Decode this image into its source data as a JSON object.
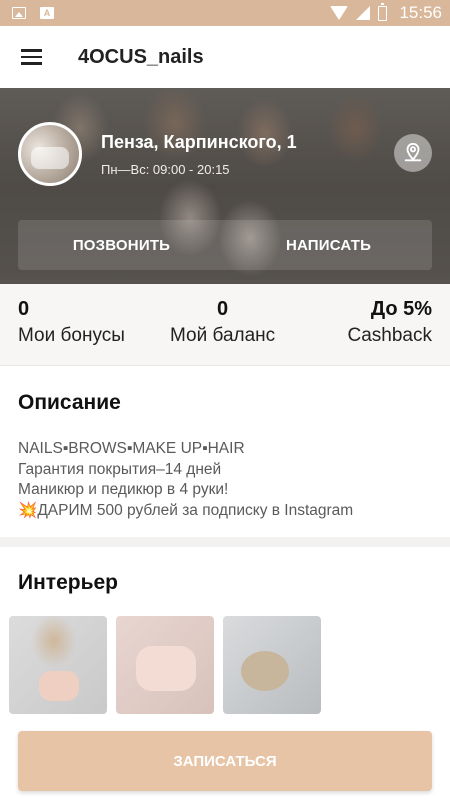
{
  "status_bar": {
    "time": "15:56"
  },
  "app_bar": {
    "title": "4OCUS_nails"
  },
  "salon": {
    "address": "Пенза, Карпинского, 1",
    "hours": "Пн—Вс: 09:00 - 20:15",
    "call_label": "ПОЗВОНИТЬ",
    "message_label": "НАПИСАТЬ"
  },
  "stats": {
    "bonuses": {
      "value": "0",
      "label": "Мои бонусы"
    },
    "balance": {
      "value": "0",
      "label": "Мой баланс"
    },
    "cashback": {
      "value": "До 5%",
      "label": "Cashback"
    }
  },
  "description": {
    "title": "Описание",
    "lines": [
      "NAILS▪BROWS▪MAKE UP▪HAIR",
      "Гарантия покрытия–14 дней",
      "Маникюр и педикюр в 4 руки!",
      "ДАРИМ 500 рублей за подписку в Instagram"
    ],
    "burst_icon": "💥"
  },
  "interior": {
    "title": "Интерьер"
  },
  "cta": {
    "label": "ЗАПИСАТЬСЯ"
  },
  "colors": {
    "accent": "#d8b79a",
    "cta": "#e7c4a5"
  }
}
